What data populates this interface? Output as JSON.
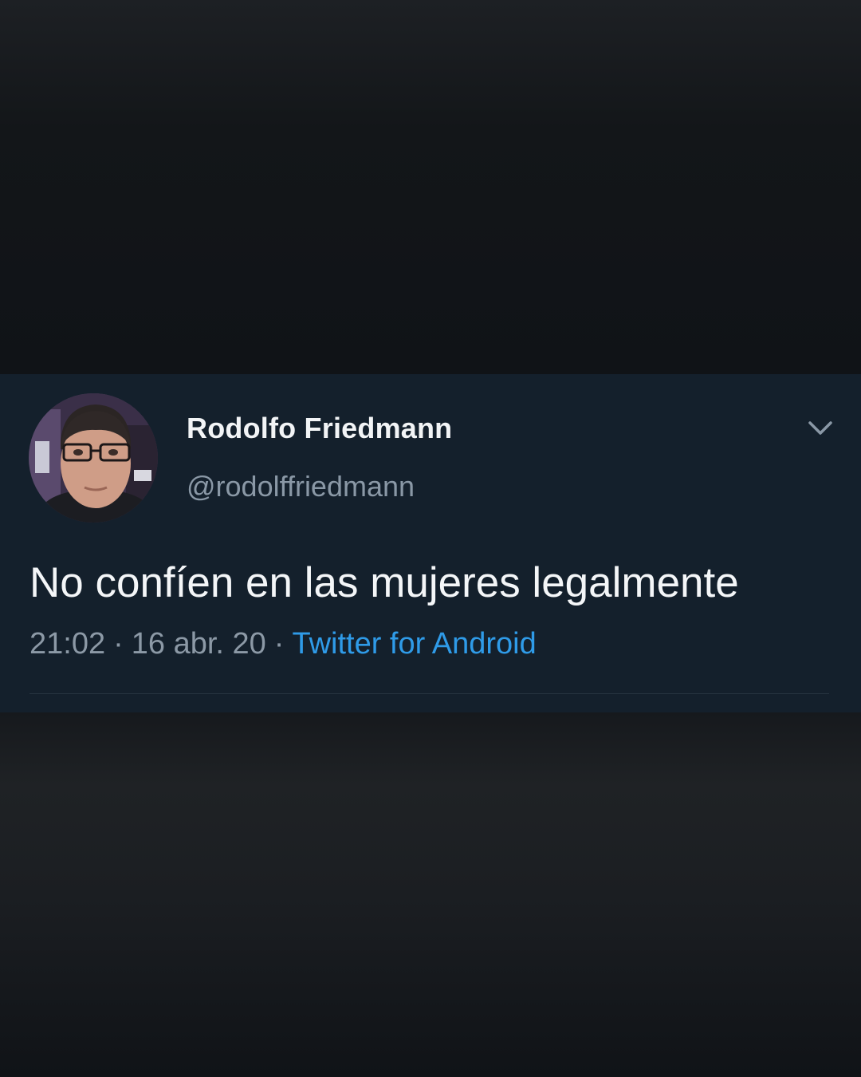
{
  "tweet": {
    "display_name": "Rodolfo Friedmann",
    "handle": "@rodolffriedmann",
    "text": "No confíen en las mujeres legalmente",
    "time": "21:02",
    "date": "16 abr. 20",
    "separator": "·",
    "source": "Twitter for Android"
  },
  "icons": {
    "menu": "chevron-down-icon",
    "avatar": "profile-photo"
  },
  "colors": {
    "card_background": "#14202c",
    "page_background": "#101317",
    "link": "#2f9be8",
    "secondary_text": "#8c99a6",
    "primary_text": "#f4f6f8"
  }
}
